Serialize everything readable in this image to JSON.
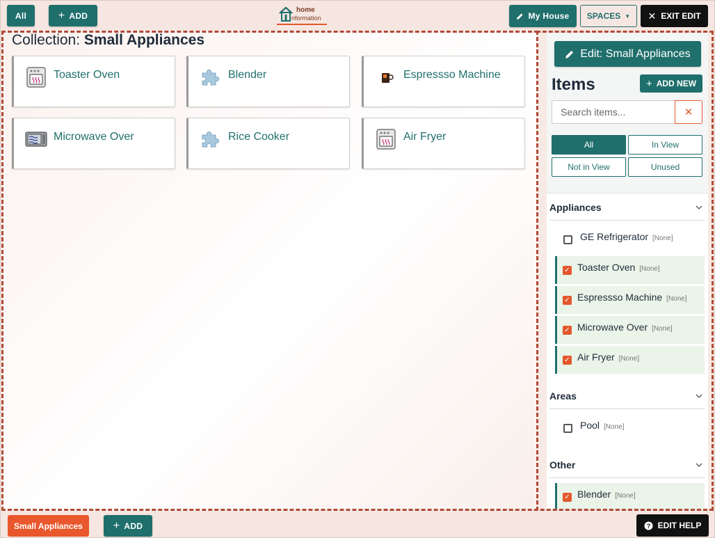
{
  "topbar": {
    "all_label": "All",
    "add_label": "ADD",
    "logo_line1": "home",
    "logo_line2": "nformation",
    "myhouse_label": "My House",
    "spaces_label": "SPACES",
    "exit_label": "EXIT EDIT"
  },
  "main": {
    "title_prefix": "Collection:",
    "title_name": "Small Appliances",
    "cards": [
      {
        "label": "Toaster Oven",
        "icon": "oven-icon"
      },
      {
        "label": "Blender",
        "icon": "puzzle-icon"
      },
      {
        "label": "Espressso Machine",
        "icon": "coffee-icon"
      },
      {
        "label": "Microwave Over",
        "icon": "microwave-icon"
      },
      {
        "label": "Rice Cooker",
        "icon": "puzzle-icon"
      },
      {
        "label": "Air Fryer",
        "icon": "oven-icon"
      }
    ]
  },
  "sidebar": {
    "edit_label": "Edit: Small Appliances",
    "items_heading": "Items",
    "add_new_label": "ADD NEW",
    "search_placeholder": "Search items...",
    "filters": [
      "All",
      "In View",
      "Not in View",
      "Unused"
    ],
    "active_filter": "All",
    "groups": [
      {
        "name": "Appliances",
        "items": [
          {
            "name": "GE Refrigerator",
            "tag": "[None]",
            "checked": false
          },
          {
            "name": "Toaster Oven",
            "tag": "[None]",
            "checked": true
          },
          {
            "name": "Espressso Machine",
            "tag": "[None]",
            "checked": true
          },
          {
            "name": "Microwave Over",
            "tag": "[None]",
            "checked": true
          },
          {
            "name": "Air Fryer",
            "tag": "[None]",
            "checked": true
          }
        ]
      },
      {
        "name": "Areas",
        "items": [
          {
            "name": "Pool",
            "tag": "[None]",
            "checked": false
          }
        ]
      },
      {
        "name": "Other",
        "items": [
          {
            "name": "Blender",
            "tag": "[None]",
            "checked": true
          }
        ]
      }
    ]
  },
  "bottombar": {
    "collection_label": "Small Appliances",
    "add_label": "ADD",
    "help_label": "EDIT HELP"
  },
  "colors": {
    "teal": "#1f6f6c",
    "orange": "#e9572c",
    "selected_row_bg": "#eaf4e8"
  }
}
